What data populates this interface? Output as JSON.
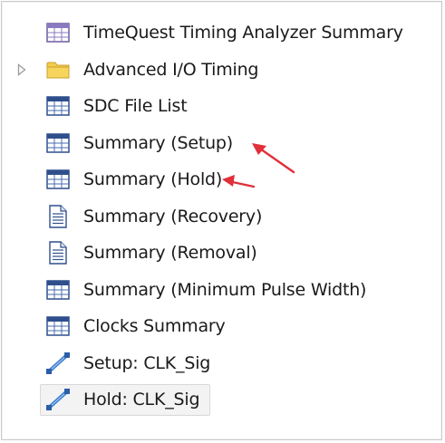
{
  "tree": {
    "items": [
      {
        "label": "TimeQuest Timing Analyzer Summary",
        "icon": "table-icon",
        "expandable": false,
        "selected": false
      },
      {
        "label": "Advanced I/O Timing",
        "icon": "folder-icon",
        "expandable": true,
        "selected": false
      },
      {
        "label": "SDC File List",
        "icon": "table-icon",
        "expandable": false,
        "selected": false
      },
      {
        "label": "Summary (Setup)",
        "icon": "table-icon",
        "expandable": false,
        "selected": false
      },
      {
        "label": "Summary (Hold)",
        "icon": "table-icon",
        "expandable": false,
        "selected": false
      },
      {
        "label": "Summary (Recovery)",
        "icon": "document-icon",
        "expandable": false,
        "selected": false
      },
      {
        "label": "Summary (Removal)",
        "icon": "document-icon",
        "expandable": false,
        "selected": false
      },
      {
        "label": "Summary (Minimum Pulse Width)",
        "icon": "table-icon",
        "expandable": false,
        "selected": false
      },
      {
        "label": "Clocks Summary",
        "icon": "table-icon",
        "expandable": false,
        "selected": false
      },
      {
        "label": "Setup: CLK_Sig",
        "icon": "timing-path-icon",
        "expandable": false,
        "selected": false
      },
      {
        "label": "Hold: CLK_Sig",
        "icon": "timing-path-icon",
        "expandable": false,
        "selected": true
      }
    ]
  },
  "colors": {
    "annotation_arrow": "#e0303a",
    "table_header": "#2f4f8c",
    "folder": "#f2c744",
    "selection": "#f3f3f3"
  }
}
